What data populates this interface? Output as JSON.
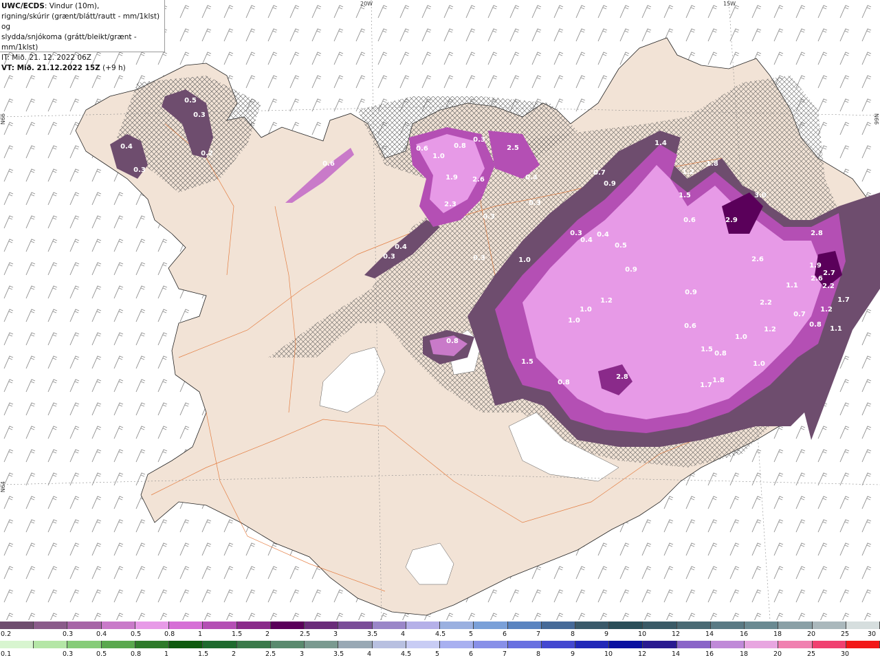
{
  "header": {
    "product": "UWC/ECDS",
    "line1_rest": ": Vindur (10m),",
    "line2": "rigning/skúrir (grænt/blátt/rautt - mm/1klst) og",
    "line3": "slydda/snjókoma (grátt/bleikt/grænt - mm/1klst)",
    "it": "IT: Mið. 21. 12. 2022 06Z",
    "vt_bold": "VT: Mið. 21.12.2022 15Z",
    "vt_rest": " (+9 h)"
  },
  "grid_labels": {
    "lon_20w": "20W",
    "lon_15w": "15W",
    "lat_66n_left": "N66",
    "lat_66n_right": "N66",
    "lat_64n_left": "N64"
  },
  "precip_labels": [
    "0.5",
    "0.3",
    "0.4",
    "0.3",
    "0.2",
    "0.6",
    "0.6",
    "1.0",
    "0.8",
    "0.3",
    "2.5",
    "1.4",
    "1.9",
    "2.6",
    "2.3",
    "0.4",
    "0.3",
    "0.3",
    "0.4",
    "0.3",
    "0.7",
    "0.9",
    "1.2",
    "1.8",
    "1.5",
    "0.6",
    "3.0",
    "2.9",
    "2.8",
    "1.9",
    "2.7",
    "2.6",
    "2.2",
    "1.7",
    "0.3",
    "0.4",
    "0.4",
    "0.5",
    "0.3",
    "1.0",
    "0.9",
    "1.2",
    "1.0",
    "1.0",
    "0.9",
    "0.6",
    "2.6",
    "1.1",
    "2.2",
    "1.2",
    "0.7",
    "0.8",
    "1.2",
    "1.1",
    "1.0",
    "1.5",
    "0.8",
    "1.0",
    "0.8",
    "1.5",
    "0.8",
    "2.8",
    "1.7",
    "1.8",
    "0.3"
  ],
  "snow_scale": {
    "labels": [
      "0.2",
      "0.3",
      "0.4",
      "0.5",
      "0.8",
      "1",
      "1.5",
      "2",
      "2.5",
      "3",
      "3.5",
      "4",
      "4.5",
      "5",
      "6",
      "7",
      "8",
      "9",
      "10",
      "12",
      "14",
      "16",
      "18",
      "20",
      "25",
      "30"
    ],
    "colors": [
      "#6e4d6e",
      "#8a5b8a",
      "#a765a7",
      "#c97ac9",
      "#e79ae7",
      "#d66fd6",
      "#b44fb4",
      "#8a2a8a",
      "#5a005a",
      "#6a2c7a",
      "#7a4c98",
      "#9a86c8",
      "#b5b0e8",
      "#9ab0e0",
      "#7aa0d8",
      "#5a84c0",
      "#466a98",
      "#3a5a6a",
      "#2a4e58",
      "#3a5a66",
      "#4a6a74",
      "#5a7a84",
      "#6a8a92",
      "#8aa0a6",
      "#aab8bc",
      "#d6dede"
    ]
  },
  "rain_scale": {
    "labels": [
      "0.1",
      "0.3",
      "0.5",
      "0.8",
      "1",
      "1.5",
      "2",
      "2.5",
      "3",
      "3.5",
      "4",
      "4.5",
      "5",
      "6",
      "7",
      "8",
      "9",
      "10",
      "12",
      "14",
      "16",
      "18",
      "20",
      "25",
      "30"
    ],
    "colors": [
      "#d8f5d0",
      "#b4e6a6",
      "#86cc78",
      "#5aa84e",
      "#2e7a2a",
      "#0e5a0e",
      "#1e6a2e",
      "#3a7a4a",
      "#5a8a6e",
      "#7a9a90",
      "#98a8b4",
      "#b8c0e0",
      "#c8ccf4",
      "#a8b0f0",
      "#8890e8",
      "#6870e0",
      "#4448d0",
      "#2228b8",
      "#0a10a0",
      "#2a1a90",
      "#8a64c8",
      "#c08ad8",
      "#e8a6e0",
      "#f080b0",
      "#f04070",
      "#f21818"
    ]
  },
  "colors": {
    "land": "#f2e3d6",
    "roads": "#e0651e",
    "glacier": "#ffffff",
    "ocean": "#ffffff",
    "wind_barb": "#888888"
  }
}
